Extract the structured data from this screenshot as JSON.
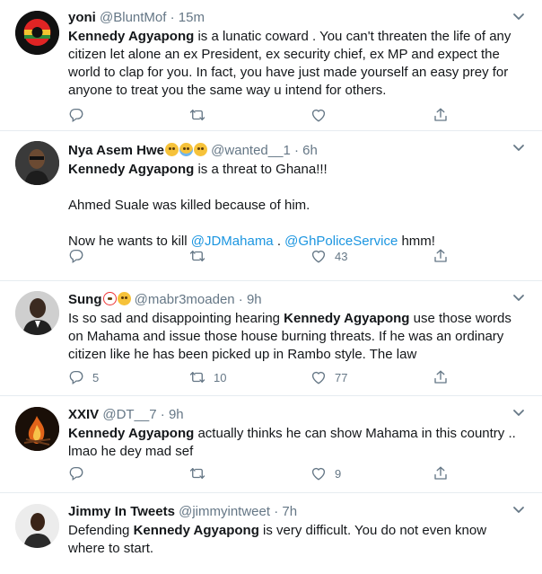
{
  "tweets": [
    {
      "name": "yoni",
      "handle": "@BluntMof",
      "time": "15m",
      "text_parts": [
        {
          "bold": "Kennedy Agyapong"
        },
        {
          "plain": " is a lunatic coward . You can't threaten the life of any citizen let alone an ex President, ex security chief, ex MP and expect the world to clap for you. In fact, you have just made yourself an easy prey for anyone to treat you the same way u intend for others."
        }
      ],
      "replies": "",
      "retweets": "",
      "likes": ""
    },
    {
      "name": "Nya Asem Hwe",
      "handle": "@wanted__1",
      "time": "6h",
      "line1_bold": "Kennedy Agyapong",
      "line1_plain": " is a threat to Ghana!!!",
      "line2": "Ahmed Suale was killed because of him.",
      "line3_pre": "Now he wants to kill ",
      "link1": "@JDMahama",
      "line3_mid": " . ",
      "link2": "@GhPoliceService",
      "line3_post": " hmm!",
      "replies": "",
      "retweets": "",
      "likes": "43"
    },
    {
      "name": "Sung",
      "handle": "@mabr3moaden",
      "time": "9h",
      "text_pre": "Is so sad and disappointing hearing ",
      "text_bold": "Kennedy Agyapong",
      "text_post": " use those words on Mahama and issue those house burning threats. If he was an ordinary citizen like he has been picked up in Rambo style. The law",
      "replies": "5",
      "retweets": "10",
      "likes": "77"
    },
    {
      "name": "XXIV",
      "handle": "@DT__7",
      "time": "9h",
      "text_bold": "Kennedy Agyapong",
      "text_post": " actually thinks he can show Mahama in this country .. lmao he dey mad sef",
      "replies": "",
      "retweets": "",
      "likes": "9"
    },
    {
      "name": "Jimmy In Tweets",
      "handle": "@jimmyintweet",
      "time": "7h",
      "text_pre": "Defending ",
      "text_bold": "Kennedy Agyapong",
      "text_post": " is very difficult. You do not even know where to start."
    }
  ],
  "separator": "·",
  "icons": [
    "reply-icon",
    "retweet-icon",
    "like-icon",
    "share-icon",
    "caret-down-icon"
  ],
  "colors": {
    "text": "#14171a",
    "muted": "#657786",
    "link": "#1b95e0",
    "border": "#e6ecf0"
  }
}
